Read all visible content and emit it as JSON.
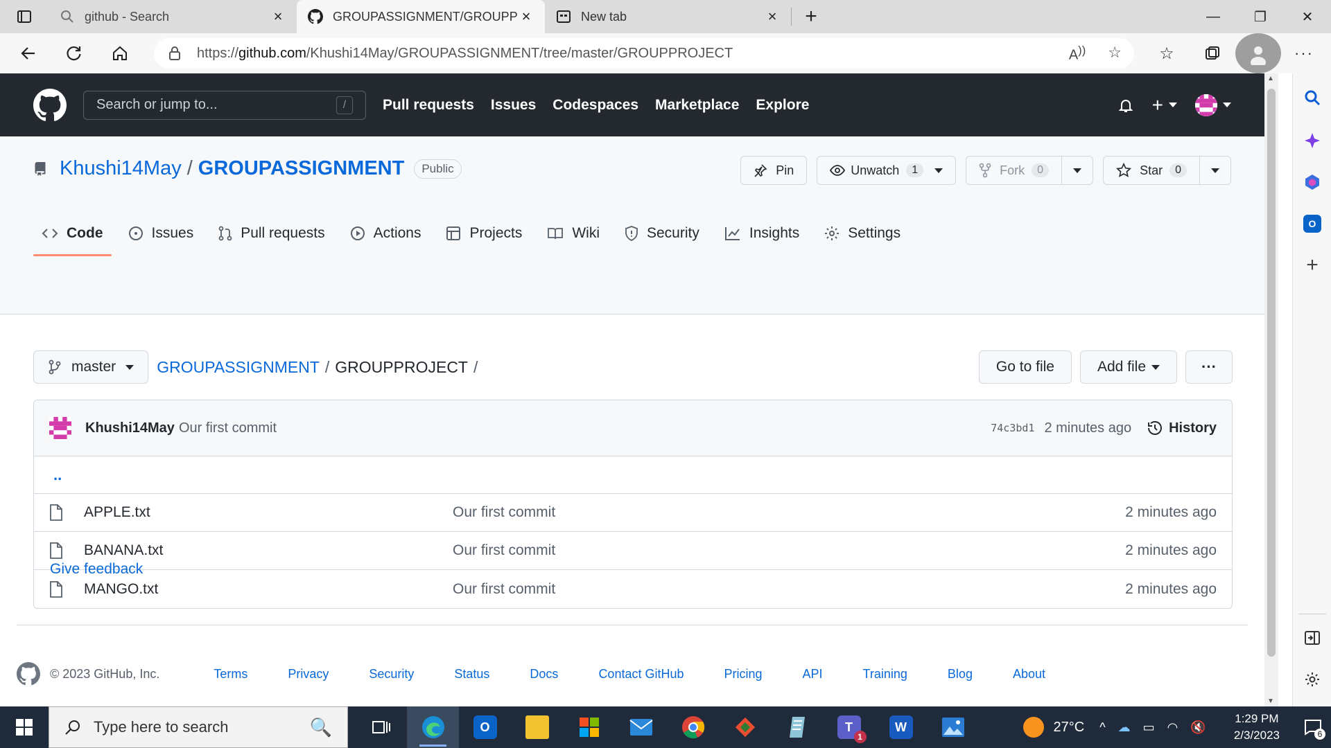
{
  "browser": {
    "tabs": [
      {
        "label": "github - Search",
        "icon": "search-icon",
        "active": false
      },
      {
        "label": "GROUPASSIGNMENT/GROUPPROJECT",
        "icon": "github-icon",
        "active": true
      },
      {
        "label": "New tab",
        "icon": "newtab-icon",
        "active": false
      }
    ],
    "url_prefix": "https://",
    "url_host": "github.com",
    "url_path": "/Khushi14May/GROUPASSIGNMENT/tree/master/GROUPPROJECT"
  },
  "gh_header": {
    "search_placeholder": "Search or jump to...",
    "search_shortcut": "/",
    "nav": [
      "Pull requests",
      "Issues",
      "Codespaces",
      "Marketplace",
      "Explore"
    ]
  },
  "repo": {
    "owner": "Khushi14May",
    "separator": "/",
    "name": "GROUPASSIGNMENT",
    "visibility": "Public",
    "pin_label": "Pin",
    "watch_label": "Unwatch",
    "watch_count": "1",
    "fork_label": "Fork",
    "fork_count": "0",
    "star_label": "Star",
    "star_count": "0",
    "tabs": [
      "Code",
      "Issues",
      "Pull requests",
      "Actions",
      "Projects",
      "Wiki",
      "Security",
      "Insights",
      "Settings"
    ]
  },
  "file_browser": {
    "branch": "master",
    "crumb_root": "GROUPASSIGNMENT",
    "crumb_sep": "/",
    "crumb_current": "GROUPPROJECT",
    "crumb_trail": "/",
    "go_to_file": "Go to file",
    "add_file": "Add file",
    "more": "···"
  },
  "latest_commit": {
    "author": "Khushi14May",
    "message": "Our first commit",
    "sha": "74c3bd1",
    "age": "2 minutes ago",
    "history_label": "History"
  },
  "parent_dir": "..",
  "files": [
    {
      "name": "APPLE.txt",
      "commit": "Our first commit",
      "age": "2 minutes ago"
    },
    {
      "name": "BANANA.txt",
      "commit": "Our first commit",
      "age": "2 minutes ago"
    },
    {
      "name": "MANGO.txt",
      "commit": "Our first commit",
      "age": "2 minutes ago"
    }
  ],
  "feedback_link": "Give feedback",
  "footer": {
    "copyright": "© 2023 GitHub, Inc.",
    "links": [
      "Terms",
      "Privacy",
      "Security",
      "Status",
      "Docs",
      "Contact GitHub",
      "Pricing",
      "API",
      "Training",
      "Blog",
      "About"
    ]
  },
  "taskbar": {
    "search_placeholder": "Type here to search",
    "weather_temp": "27°C",
    "time": "1:29 PM",
    "date": "2/3/2023",
    "notification_count": "6",
    "teams_badge": "1"
  },
  "colors": {
    "gh_header_bg": "#24292f",
    "link_blue": "#0969da",
    "tab_underline": "#fd8c73",
    "taskbar_bg": "#1f2a3a"
  }
}
